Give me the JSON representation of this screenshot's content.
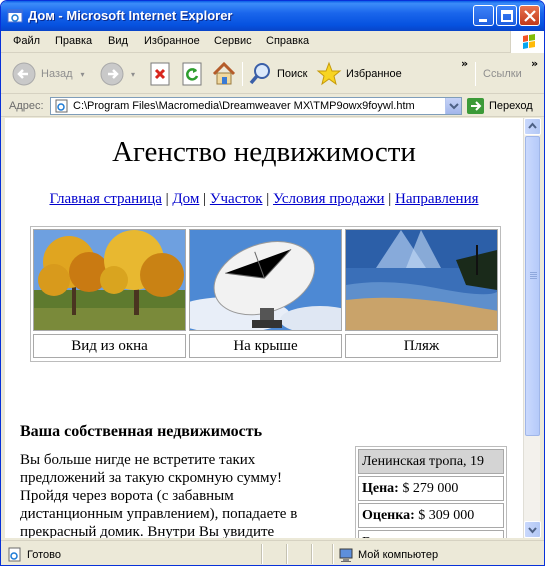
{
  "window": {
    "title": "Дом - Microsoft Internet Explorer",
    "buttons": [
      "minimize",
      "maximize",
      "close"
    ]
  },
  "menu": [
    {
      "label": "Файл"
    },
    {
      "label": "Правка"
    },
    {
      "label": "Вид"
    },
    {
      "label": "Избранное"
    },
    {
      "label": "Сервис"
    },
    {
      "label": "Справка"
    }
  ],
  "toolbar": {
    "back_label": "Назад",
    "search_label": "Поиск",
    "favorites_label": "Избранное",
    "links_label": "Ссылки",
    "icons": [
      "back-arrow-icon",
      "forward-arrow-icon",
      "stop-icon",
      "refresh-icon",
      "home-icon",
      "search-icon",
      "favorites-star-icon"
    ]
  },
  "address": {
    "label": "Адрес:",
    "value": "C:\\Program Files\\Macromedia\\Dreamweaver MX\\TMP9owx9foywl.htm",
    "go_label": "Переход"
  },
  "page": {
    "title": "Агенство недвижимости",
    "nav": [
      {
        "label": "Главная страница"
      },
      {
        "label": "Дом"
      },
      {
        "label": "Участок"
      },
      {
        "label": "Условия продажи"
      },
      {
        "label": "Направления"
      }
    ],
    "nav_separator": "|",
    "gallery": [
      {
        "caption": "Вид из окна",
        "image": "autumn-trees-photo"
      },
      {
        "caption": "На крыше",
        "image": "satellite-dish-photo"
      },
      {
        "caption": "Пляж",
        "image": "beach-photo"
      }
    ],
    "section_title": "Ваша собственная недвижимость",
    "body_text": "Вы больше нигде не встретите таких предложений за такую скромную сумму! Пройдя через ворота (с забавным дистанционным управлением), попадаете в прекрасный домик. Внутри Вы увидите",
    "info": {
      "address": "Ленинская тропа, 19",
      "price_label": "Цена:",
      "price_value": "$ 279 000",
      "estimate_label": "Оценка:",
      "estimate_value": "$ 309 000",
      "note": "Владелец переезжает"
    }
  },
  "status": {
    "text": "Готово",
    "zone": "Мой компьютер"
  },
  "colors": {
    "titlebar": "#0a5fe8",
    "chrome": "#ece9d8",
    "link": "#0000cc"
  }
}
